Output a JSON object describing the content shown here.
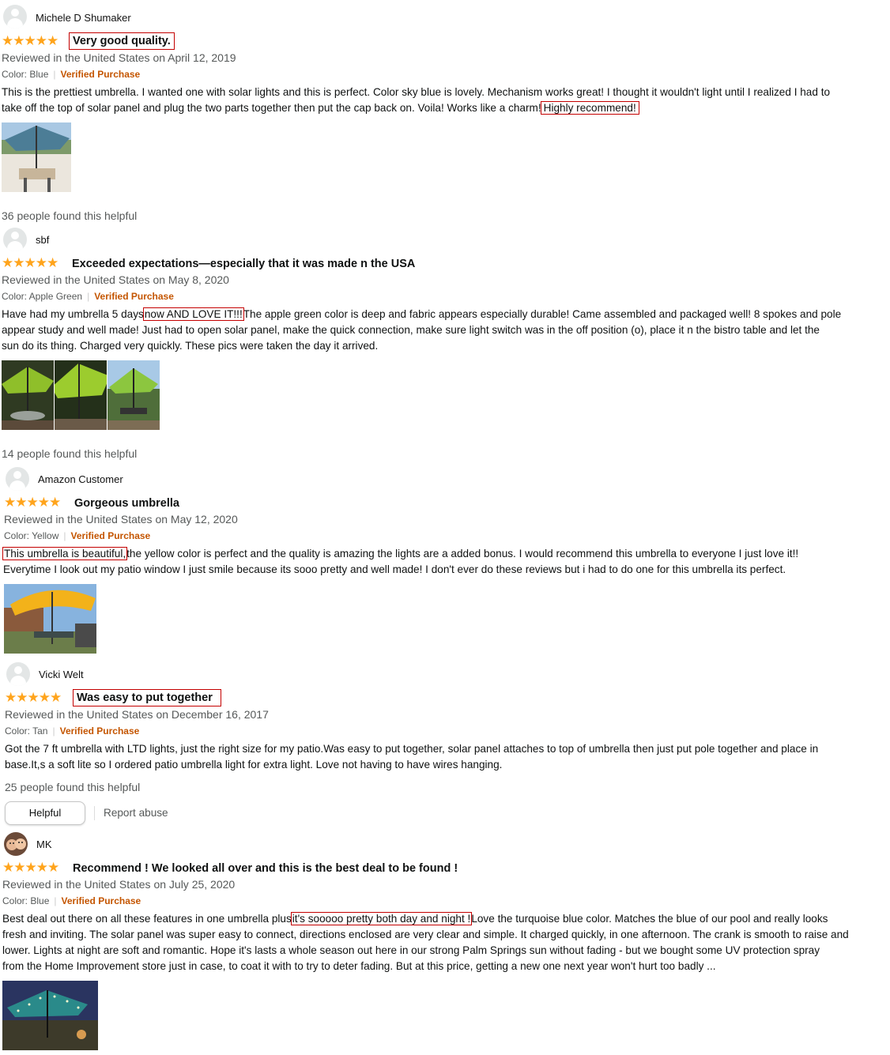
{
  "colors": {
    "star": "#ffa41c",
    "verified": "#c45500",
    "highlight": "#c40000",
    "muted": "#565959"
  },
  "reviews": [
    {
      "name": "Michele D Shumaker",
      "stars": "★★★★★",
      "title": "Very good quality.",
      "date": "Reviewed in the United States on April 12, 2019",
      "color": "Color: Blue",
      "verified": "Verified Purchase",
      "body_lines": [
        "This is the prettiest umbrella. I wanted one with solar lights and this is perfect. Color sky blue is lovely. Mechanism works great! I thought it wouldn't light until I realized I had to",
        "take off the top of solar panel and plug the two parts together then put the cap back on. Voila! Works like a charm!"
      ],
      "highlight": "Highly recommend! ",
      "helpful": "36 people found this helpful"
    },
    {
      "name": "sbf",
      "stars": "★★★★★",
      "title": "Exceeded expectations—especially that it was made n the USA",
      "date": "Reviewed in the United States on May 8, 2020",
      "color": "Color: Apple Green",
      "verified": "Verified Purchase",
      "line1_pre": "Have had my umbrella 5 days",
      "highlight": "now AND LOVE IT!!!",
      "line1_post": "The apple green color is deep and fabric appears especially durable! Came assembled and packaged well! 8 spokes and pole",
      "body_lines": [
        "appear study and well made! Just had to open solar panel, make the quick connection, make sure light switch was in the off position (o), place it n the bistro table and let the",
        "sun do its thing. Charged very quickly. These pics were taken the day it arrived."
      ],
      "helpful": "14 people found this helpful"
    },
    {
      "name": "Amazon Customer",
      "stars": "★★★★★",
      "title": "Gorgeous umbrella",
      "date": "Reviewed in the United States on May 12, 2020",
      "color": "Color: Yellow",
      "verified": "Verified Purchase",
      "highlight": "This umbrella is beautiful,",
      "line1_post": "the yellow color is perfect and the quality is amazing the lights are a added bonus. I would recommend this umbrella to everyone I just love it!!",
      "body_lines": [
        "Everytime I look out my patio window I just smile because its sooo pretty and well made! I don't ever do these reviews but i had to do one for this umbrella its perfect."
      ]
    },
    {
      "name": "Vicki Welt",
      "stars": "★★★★★",
      "title": "Was easy to put together",
      "date": "Reviewed in the United States on December 16, 2017",
      "color": "Color: Tan",
      "verified": "Verified Purchase",
      "body_lines": [
        "Got the 7 ft umbrella with LTD lights, just the right size for my patio.Was easy to put together, solar panel attaches to top of umbrella then just put pole together and place in",
        "base.It,s a soft lite so I ordered patio umbrella light for extra light. Love not having to have wires hanging."
      ],
      "helpful": "25 people found this helpful",
      "helpful_button": "Helpful",
      "report": "Report abuse"
    },
    {
      "name": "MK",
      "stars": "★★★★★",
      "title": "Recommend ! We looked all over and this is the best deal to be found !",
      "date": "Reviewed in the United States on July 25, 2020",
      "color": "Color: Blue",
      "verified": "Verified Purchase",
      "line1_pre": "Best deal out there on all these features in one umbrella plus",
      "highlight": "it's sooooo pretty both day and night !",
      "line1_post": "Love the turquoise blue color. Matches the blue of our pool and really looks",
      "body_lines": [
        "fresh and inviting. The solar panel was super easy to connect, directions enclosed are very clear and simple. It charged quickly, in one afternoon. The crank is smooth to raise and",
        "lower. Lights at night are soft and romantic. Hope it's lasts a whole season out here in our strong Palm Springs sun without fading - but we bought some UV protection spray",
        "from the Home Improvement store just in case, to coat it with to try to deter fading. But at this price, getting a new one next year won't hurt too badly ..."
      ]
    }
  ]
}
